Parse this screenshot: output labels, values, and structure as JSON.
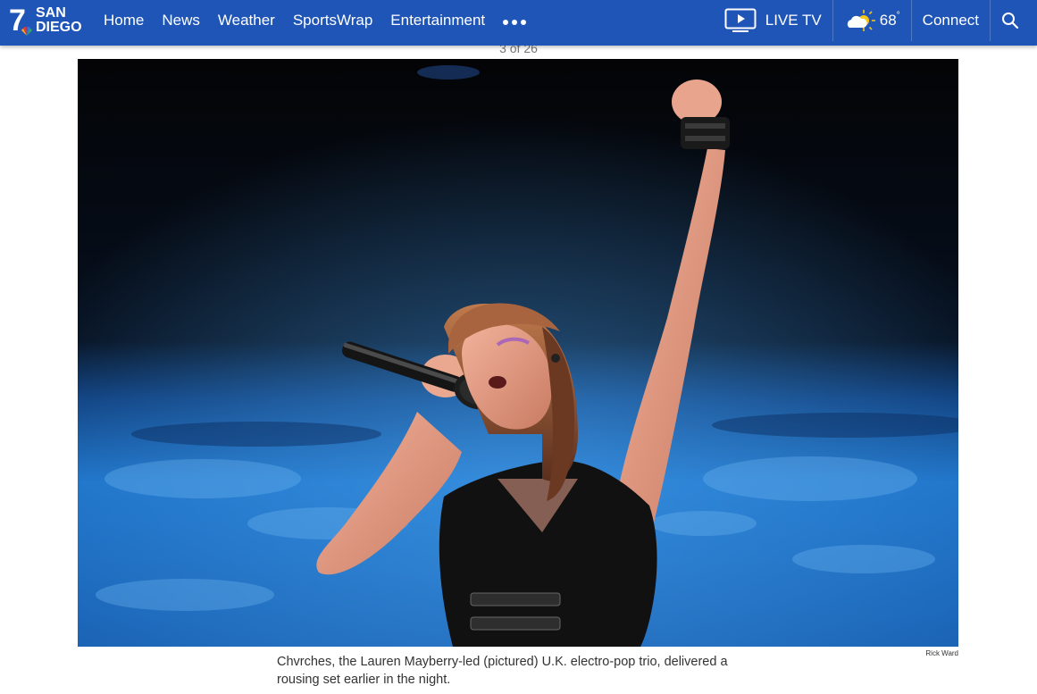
{
  "logo": {
    "number": "7",
    "line1": "SAN",
    "line2": "DIEGO"
  },
  "nav": {
    "items": [
      {
        "id": "home",
        "label": "Home"
      },
      {
        "id": "news",
        "label": "News"
      },
      {
        "id": "weather",
        "label": "Weather"
      },
      {
        "id": "sportswrap",
        "label": "SportsWrap"
      },
      {
        "id": "entertainment",
        "label": "Entertainment"
      }
    ],
    "more_icon": "more-horizontal-icon"
  },
  "header_tools": {
    "live_tv": {
      "icon": "tv-play-icon",
      "label": "LIVE TV"
    },
    "weather": {
      "icon": "partly-cloudy-icon",
      "temperature": "68",
      "unit": "°"
    },
    "connect": {
      "label": "Connect"
    },
    "search": {
      "icon": "search-icon"
    }
  },
  "gallery": {
    "counter": "3 of 26",
    "photo_credit": "Rick Ward",
    "caption": "Chvrches, the Lauren Mayberry-led (pictured) U.K. electro-pop trio, delivered a rousing set earlier in the night."
  },
  "colors": {
    "brand_blue": "#1f55b7",
    "caption_text": "#333333",
    "counter_text": "#777777",
    "stage_blue": "#1e73c8"
  }
}
